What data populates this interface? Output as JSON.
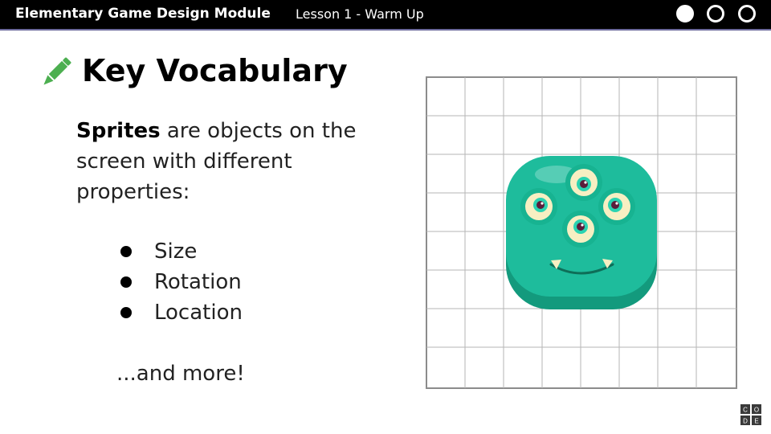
{
  "header": {
    "module_title": "Elementary Game Design Module",
    "lesson_title": "Lesson 1 - Warm Up",
    "progress": {
      "total": 3,
      "completed": 1
    }
  },
  "slide": {
    "title": "Key Vocabulary",
    "title_icon": "pencil-icon",
    "term": "Sprites",
    "definition": " are objects on the screen with different properties:",
    "properties": [
      "Size",
      "Rotation",
      "Location"
    ],
    "closing": "...and more!"
  },
  "illustration": {
    "subject": "three-eyed-monster-sprite",
    "background": "grid"
  },
  "logo": {
    "letters": [
      "C",
      "O",
      "D",
      "E"
    ]
  },
  "colors": {
    "header_bg": "#000000",
    "header_rule": "#6d6a9c",
    "pencil": "#4caf50",
    "sprite_body": "#1ebc9c",
    "sprite_shadow": "#139a7d",
    "grid_line": "#8c8c8c"
  }
}
